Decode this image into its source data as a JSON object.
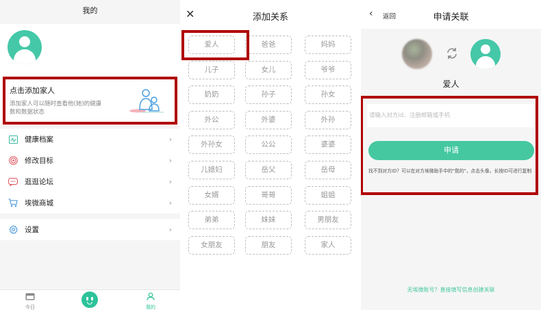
{
  "panel1": {
    "title": "我的",
    "add_family": {
      "title": "点击添加家人",
      "desc": "添加家人可以随时查看他(她)的健康数和数据状态"
    },
    "menu_group1": [
      {
        "label": "健康档案",
        "icon": "health-record-icon"
      },
      {
        "label": "修改目标",
        "icon": "target-icon"
      },
      {
        "label": "逛逛论坛",
        "icon": "forum-icon"
      },
      {
        "label": "埃微商城",
        "icon": "cart-icon"
      }
    ],
    "menu_group2": [
      {
        "label": "设置",
        "icon": "gear-icon"
      }
    ],
    "tabs": {
      "today": "今日",
      "mine": "我的"
    }
  },
  "panel2": {
    "title": "添加关系",
    "close": "✕",
    "relations": [
      "爱人",
      "爸爸",
      "妈妈",
      "儿子",
      "女儿",
      "爷爷",
      "奶奶",
      "孙子",
      "孙女",
      "外公",
      "外婆",
      "外孙",
      "外孙女",
      "公公",
      "婆婆",
      "儿媳妇",
      "岳父",
      "岳母",
      "女婿",
      "哥哥",
      "姐姐",
      "弟弟",
      "妹妹",
      "男朋友",
      "女朋友",
      "朋友",
      "家人"
    ]
  },
  "panel3": {
    "back": "返回",
    "title": "申请关联",
    "relation": "爱人",
    "input_placeholder": "请输入对方id、注册邮箱或手机",
    "apply": "申请",
    "hint": "找不到对方ID？可以在对方埃微助手中的\"我的\"，点击头像，长按ID可进行复制",
    "footer_link": "无埃微账号？直接填写信息创建关联"
  },
  "colors": {
    "accent": "#45c8a0",
    "highlight": "#b00000"
  }
}
